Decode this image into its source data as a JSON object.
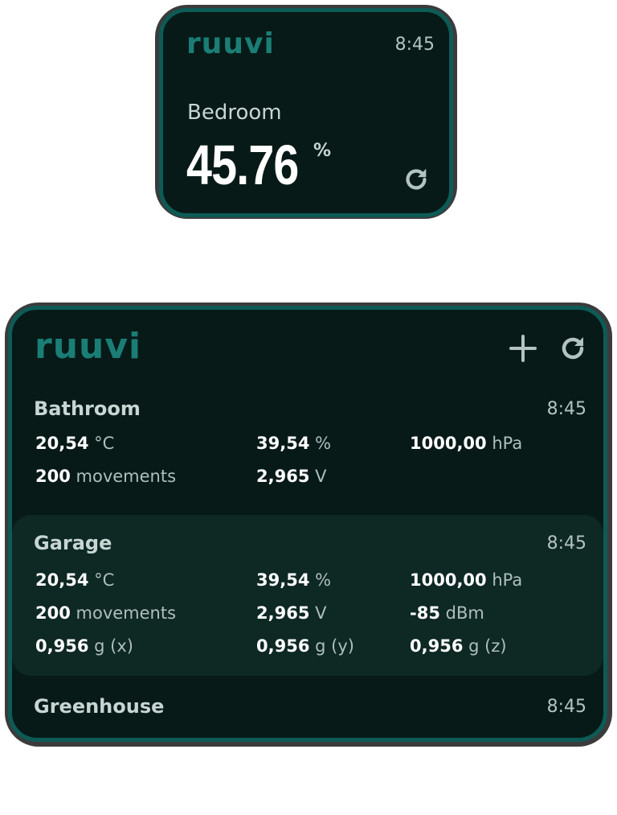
{
  "small_widget": {
    "logo": "ruuvi",
    "time": "8:45",
    "sensor_name": "Bedroom",
    "value": "45.76",
    "unit": "%"
  },
  "large_widget": {
    "logo": "ruuvi",
    "sensors": [
      {
        "name": "Bathroom",
        "time": "8:45",
        "readings": [
          {
            "value": "20,54",
            "unit": "°C"
          },
          {
            "value": "39,54",
            "unit": "%"
          },
          {
            "value": "1000,00",
            "unit": "hPa"
          },
          {
            "value": "200",
            "unit": "movements"
          },
          {
            "value": "2,965",
            "unit": "V"
          }
        ]
      },
      {
        "name": "Garage",
        "time": "8:45",
        "readings": [
          {
            "value": "20,54",
            "unit": "°C"
          },
          {
            "value": "39,54",
            "unit": "%"
          },
          {
            "value": "1000,00",
            "unit": "hPa"
          },
          {
            "value": "200",
            "unit": "movements"
          },
          {
            "value": "2,965",
            "unit": "V"
          },
          {
            "value": "-85",
            "unit": "dBm"
          },
          {
            "value": "0,956",
            "unit": "g (x)"
          },
          {
            "value": "0,956",
            "unit": "g (y)"
          },
          {
            "value": "0,956",
            "unit": "g (z)"
          }
        ]
      },
      {
        "name": "Greenhouse",
        "time": "8:45"
      }
    ]
  },
  "icons": {
    "add": "plus-icon",
    "refresh": "refresh-icon"
  },
  "colors": {
    "background": "#071a18",
    "border": "#0d5b56",
    "brand": "#1a7e76",
    "highlight": "#0e2824"
  }
}
